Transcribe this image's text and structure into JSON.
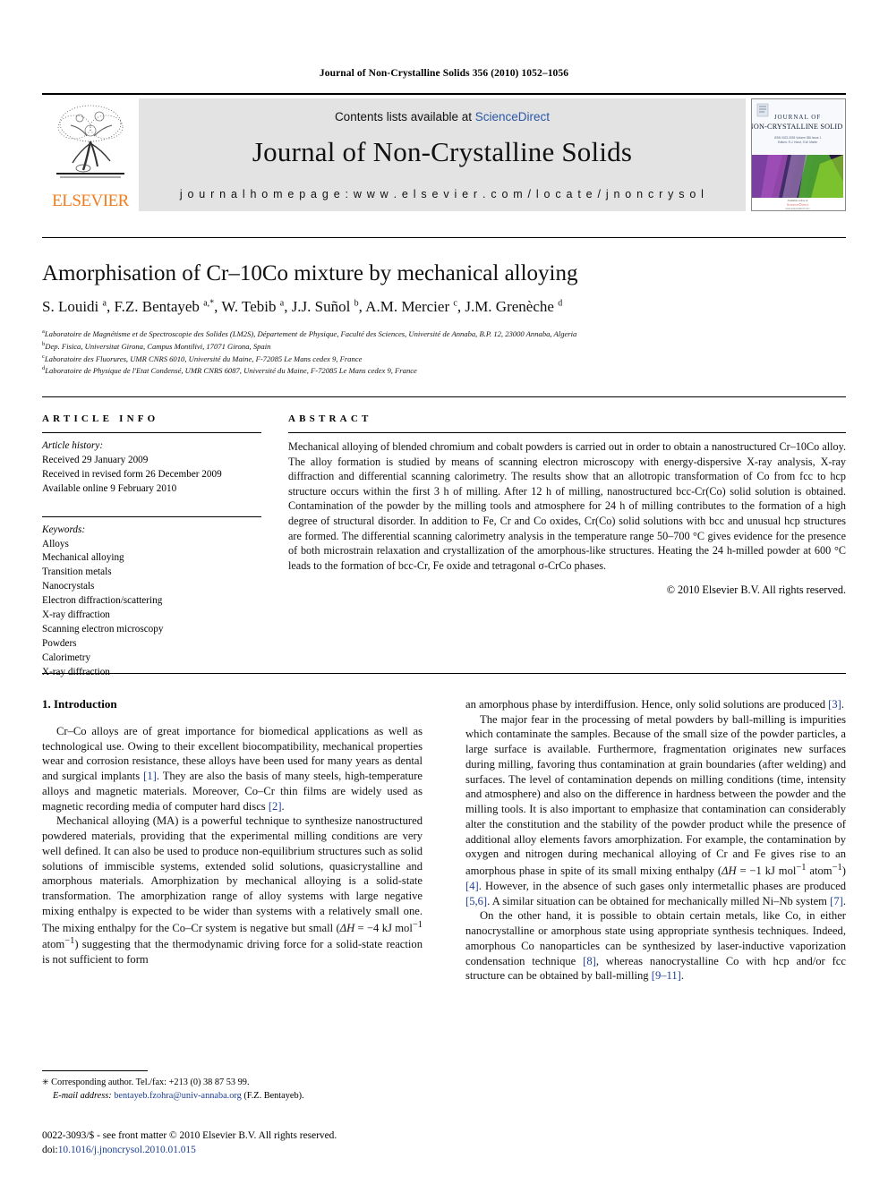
{
  "running_head": "Journal of Non-Crystalline Solids 356 (2010) 1052–1056",
  "masthead": {
    "contents_prefix": "Contents lists available at ",
    "sciencedirect": "ScienceDirect",
    "journal_title": "Journal of Non-Crystalline Solids",
    "homepage": "j o u r n a l   h o m e p a g e :   w w w . e l s e v i e r . c o m / l o c a t e / j n o n c r y s o l",
    "publisher_name": "ELSEVIER",
    "publisher_color": "#F07C1E",
    "cover": {
      "line1": "JOURNAL OF",
      "line2": "NON-CRYSTALLINE SOLIDS",
      "line3": "ISSN 0022-3093  Volume 356  Issue 1",
      "line4": "Editors: R.J. Hand, S.W. Martin",
      "footer1": "Available online at",
      "footer2": "ScienceDirect",
      "footer3": "www.sciencedirect.com"
    }
  },
  "article": {
    "title": "Amorphisation of Cr–10Co mixture by mechanical alloying",
    "authors_html": "S. Louidi <sup>a</sup>, F.Z. Bentayeb <sup>a,*</sup>, W. Tebib <sup>a</sup>, J.J. Suñol <sup>b</sup>, A.M. Mercier <sup>c</sup>, J.M. Grenèche <sup>d</sup>",
    "affiliations": [
      {
        "mark": "a",
        "text": "Laboratoire de Magnétisme et de Spectroscopie des Solides (LM2S), Département de Physique, Faculté des Sciences, Université de Annaba, B.P. 12, 23000 Annaba, Algeria"
      },
      {
        "mark": "b",
        "text": "Dep. Fisica, Universitat Girona, Campus Montilivi, 17071 Girona, Spain"
      },
      {
        "mark": "c",
        "text": "Laboratoire des Fluorures, UMR CNRS 6010, Université du Maine, F-72085 Le Mans cedex 9, France"
      },
      {
        "mark": "d",
        "text": "Laboratoire de Physique de l'Etat Condensé, UMR CNRS 6087, Université du Maine, F-72085 Le Mans cedex 9, France"
      }
    ]
  },
  "article_info": {
    "heading": "ARTICLE INFO",
    "history_label": "Article history:",
    "history": [
      "Received 29 January 2009",
      "Received in revised form 26 December 2009",
      "Available online 9 February 2010"
    ],
    "keywords_label": "Keywords:",
    "keywords": [
      "Alloys",
      "Mechanical alloying",
      "Transition metals",
      "Nanocrystals",
      "Electron diffraction/scattering",
      "X-ray diffraction",
      "Scanning electron microscopy",
      "Powders",
      "Calorimetry",
      "X-ray diffraction"
    ]
  },
  "abstract": {
    "heading": "ABSTRACT",
    "text": "Mechanical alloying of blended chromium and cobalt powders is carried out in order to obtain a nanostructured Cr–10Co alloy. The alloy formation is studied by means of scanning electron microscopy with energy-dispersive X-ray analysis, X-ray diffraction and differential scanning calorimetry. The results show that an allotropic transformation of Co from fcc to hcp structure occurs within the first 3 h of milling. After 12 h of milling, nanostructured bcc-Cr(Co) solid solution is obtained. Contamination of the powder by the milling tools and atmosphere for 24 h of milling contributes to the formation of a high degree of structural disorder. In addition to Fe, Cr and Co oxides, Cr(Co) solid solutions with bcc and unusual hcp structures are formed. The differential scanning calorimetry analysis in the temperature range 50–700 °C gives evidence for the presence of both microstrain relaxation and crystallization of the amorphous-like structures. Heating the 24 h-milled powder at 600 °C leads to the formation of bcc-Cr, Fe oxide and tetragonal σ-CrCo phases.",
    "copyright": "© 2010 Elsevier B.V. All rights reserved."
  },
  "body": {
    "section_number_title": "1. Introduction",
    "left_paragraphs": [
      "Cr–Co alloys are of great importance for biomedical applications as well as technological use. Owing to their excellent biocompatibility, mechanical properties wear and corrosion resistance, these alloys have been used for many years as dental and surgical implants [1]. They are also the basis of many steels, high-temperature alloys and magnetic materials. Moreover, Co–Cr thin films are widely used as magnetic recording media of computer hard discs [2].",
      "Mechanical alloying (MA) is a powerful technique to synthesize nanostructured powdered materials, providing that the experimental milling conditions are very well defined. It can also be used to produce non-equilibrium structures such as solid solutions of immiscible systems, extended solid solutions, quasicrystalline and amorphous materials. Amorphization by mechanical alloying is a solid-state transformation. The amorphization range of alloy systems with large negative mixing enthalpy is expected to be wider than systems with a relatively small one. The mixing enthalpy for the Co–Cr system is negative but small (ΔH = −4 kJ mol−1 atom−1) suggesting that the thermodynamic driving force for a solid-state reaction is not sufficient to form"
    ],
    "right_paragraphs": [
      "an amorphous phase by interdiffusion. Hence, only solid solutions are produced [3].",
      "The major fear in the processing of metal powders by ball-milling is impurities which contaminate the samples. Because of the small size of the powder particles, a large surface is available. Furthermore, fragmentation originates new surfaces during milling, favoring thus contamination at grain boundaries (after welding) and surfaces. The level of contamination depends on milling conditions (time, intensity and atmosphere) and also on the difference in hardness between the powder and the milling tools. It is also important to emphasize that contamination can considerably alter the constitution and the stability of the powder product while the presence of additional alloy elements favors amorphization. For example, the contamination by oxygen and nitrogen during mechanical alloying of Cr and Fe gives rise to an amorphous phase in spite of its small mixing enthalpy (ΔH = −1 kJ mol−1 atom−1) [4]. However, in the absence of such gases only intermetallic phases are produced [5,6]. A similar situation can be obtained for mechanically milled Ni–Nb system [7].",
      "On the other hand, it is possible to obtain certain metals, like Co, in either nanocrystalline or amorphous state using appropriate synthesis techniques. Indeed, amorphous Co nanoparticles can be synthesized by laser-inductive vaporization condensation technique [8], whereas nanocrystalline Co with hcp and/or fcc structure can be obtained by ball-milling [9–11]."
    ]
  },
  "footnote": {
    "corresponding": "Corresponding author. Tel./fax: +213 (0) 38 87 53 99.",
    "email_label": "E-mail address:",
    "email": "bentayeb.fzohra@univ-annaba.org",
    "email_owner": "(F.Z. Bentayeb)."
  },
  "footer": {
    "line1": "0022-3093/$ - see front matter © 2010 Elsevier B.V. All rights reserved.",
    "doi_label": "doi:",
    "doi": "10.1016/j.jnoncrysol.2010.01.015"
  },
  "colors": {
    "link": "#1c3f94",
    "sciencedirect": "#2b57a6",
    "elsevier_orange": "#F07C1E",
    "masthead_bg": "#e3e3e3"
  }
}
